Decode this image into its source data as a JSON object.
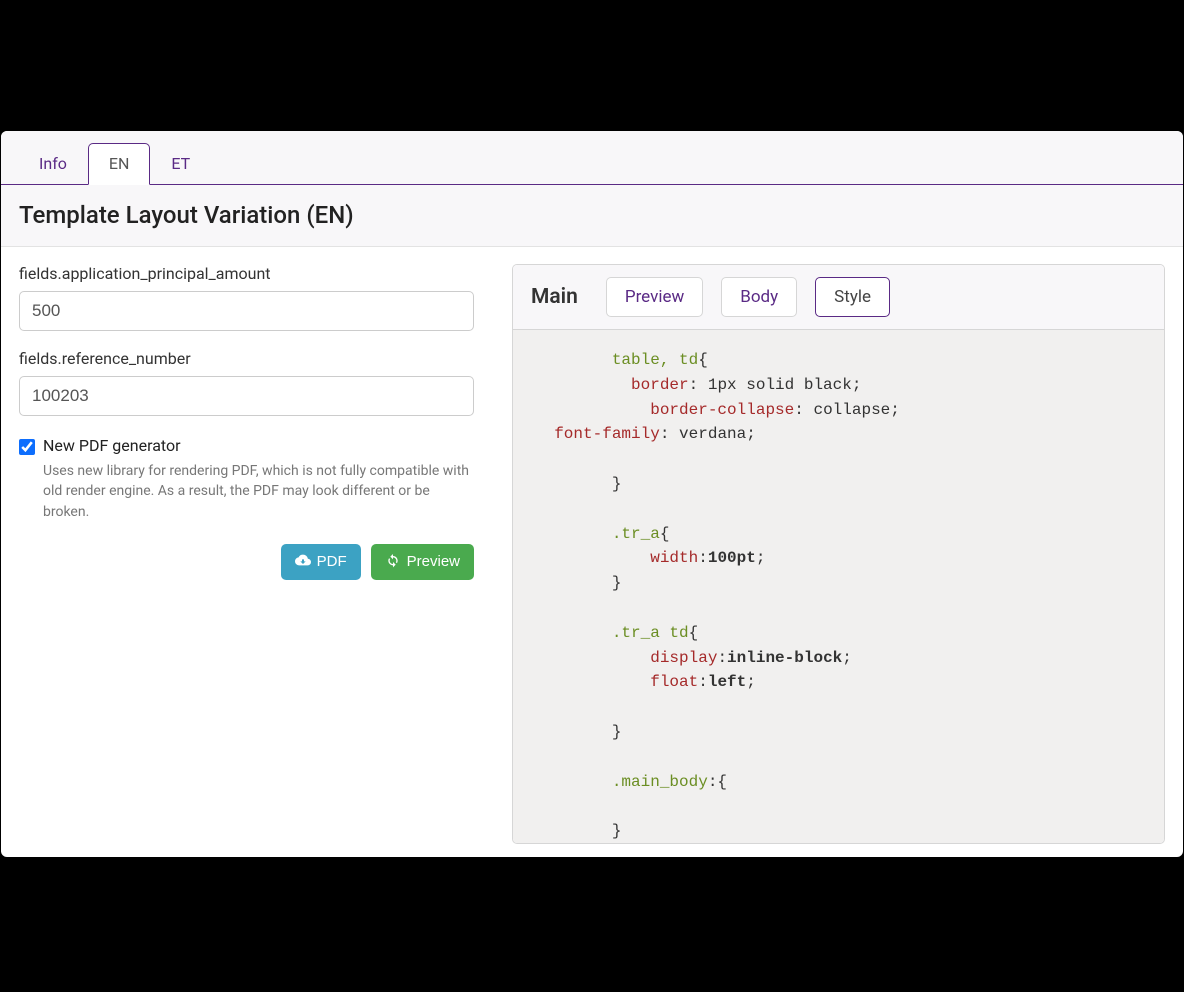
{
  "tabs": {
    "info": "Info",
    "en": "EN",
    "et": "ET"
  },
  "header": {
    "title": "Template Layout Variation (EN)"
  },
  "form": {
    "field1_label": "fields.application_principal_amount",
    "field1_value": "500",
    "field2_label": "fields.reference_number",
    "field2_value": "100203",
    "checkbox_label": "New PDF generator",
    "checkbox_help": "Uses new library for rendering PDF, which is not fully compatible with old render engine. As a result, the PDF may look different or be broken.",
    "pdf_button": "PDF",
    "preview_button": "Preview"
  },
  "right": {
    "main_label": "Main",
    "tab_preview": "Preview",
    "tab_body": "Body",
    "tab_style": "Style"
  },
  "code": {
    "l1_sel": "table, td",
    "l1_ob": "{",
    "l2_prop": "border",
    "l2_colon": ":",
    "l2_val": " 1px solid black",
    "l2_semi": ";",
    "l3_prop": "border-collapse",
    "l3_colon": ":",
    "l3_val": " collapse",
    "l3_semi": ";",
    "l4_prop": "font-family",
    "l4_colon": ":",
    "l4_val": " verdana",
    "l4_semi": ";",
    "l5_cb": "}",
    "l6_sel": ".tr_a",
    "l6_ob": "{",
    "l7_prop": "width",
    "l7_colon": ":",
    "l7_val": "100pt",
    "l7_semi": ";",
    "l8_cb": "}",
    "l9_sel": ".tr_a td",
    "l9_ob": "{",
    "l10_prop": "display",
    "l10_colon": ":",
    "l10_val": "inline-block",
    "l10_semi": ";",
    "l11_prop": "float",
    "l11_colon": ":",
    "l11_val": "left",
    "l11_semi": ";",
    "l12_cb": "}",
    "l13_sel": ".main_body",
    "l13_ob": ":{",
    "l14_cb": "}"
  }
}
